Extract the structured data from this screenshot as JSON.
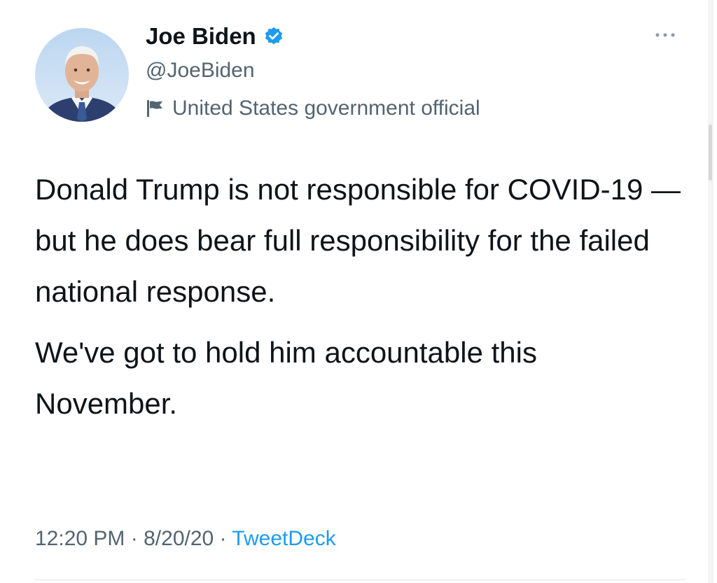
{
  "author": {
    "display_name": "Joe Biden",
    "handle": "@JoeBiden",
    "label": "United States government official",
    "verified": true,
    "avatar_icon": "profile-photo"
  },
  "tweet": {
    "paragraphs": [
      "Donald Trump is not responsible for COVID-19 — but he does bear full responsibility for the failed national response.",
      "We've got to hold him accountable this November."
    ]
  },
  "meta": {
    "time": "12:20 PM",
    "separator": "·",
    "date": "8/20/20",
    "source": "TweetDeck"
  },
  "colors": {
    "verified_blue": "#1d9bf0",
    "link_blue": "#1d9bf0",
    "secondary_text": "#536471",
    "primary_text": "#0f1419"
  },
  "icons": {
    "verified": "verified-badge-icon",
    "label": "flag-icon",
    "more": "more-dots-icon"
  }
}
